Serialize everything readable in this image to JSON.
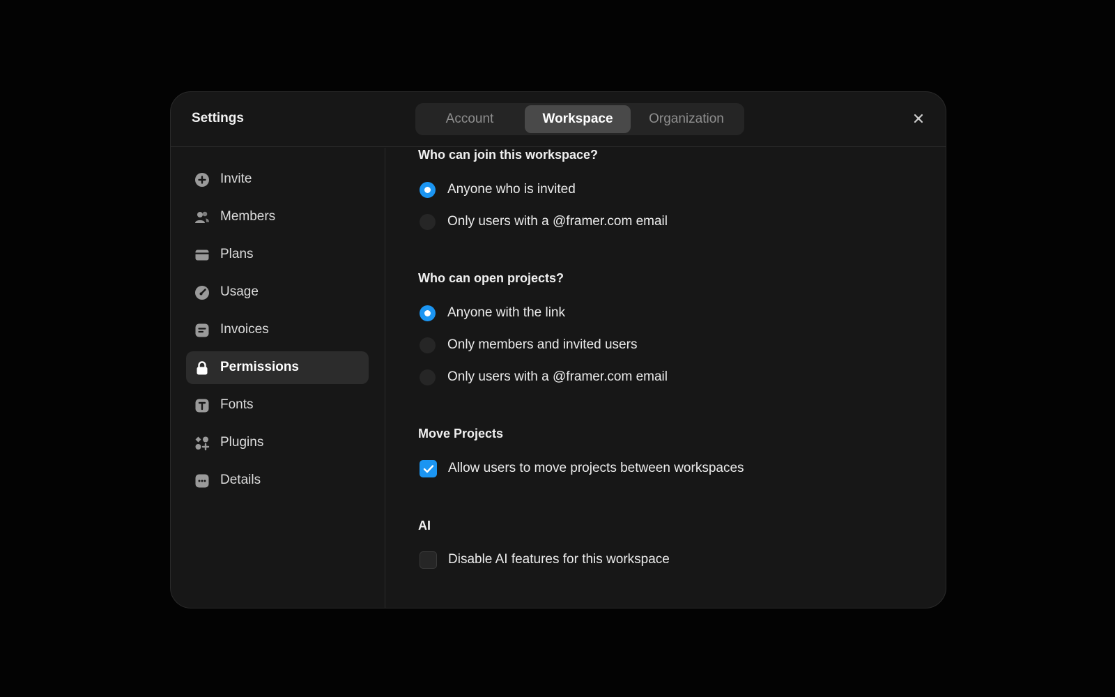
{
  "header": {
    "title": "Settings",
    "tabs": [
      {
        "label": "Account",
        "active": false
      },
      {
        "label": "Workspace",
        "active": true
      },
      {
        "label": "Organization",
        "active": false
      }
    ],
    "close_icon": "close-icon"
  },
  "sidebar": {
    "items": [
      {
        "label": "Invite",
        "icon": "plus-circle-icon",
        "active": false
      },
      {
        "label": "Members",
        "icon": "members-icon",
        "active": false
      },
      {
        "label": "Plans",
        "icon": "card-icon",
        "active": false
      },
      {
        "label": "Usage",
        "icon": "gauge-icon",
        "active": false
      },
      {
        "label": "Invoices",
        "icon": "invoice-icon",
        "active": false
      },
      {
        "label": "Permissions",
        "icon": "lock-icon",
        "active": true
      },
      {
        "label": "Fonts",
        "icon": "font-icon",
        "active": false
      },
      {
        "label": "Plugins",
        "icon": "plugins-icon",
        "active": false
      },
      {
        "label": "Details",
        "icon": "details-icon",
        "active": false
      }
    ]
  },
  "permissions": {
    "join": {
      "title": "Who can join this workspace?",
      "options": [
        {
          "label": "Anyone who is invited",
          "selected": true
        },
        {
          "label": "Only users with a @framer.com email",
          "selected": false
        }
      ]
    },
    "open": {
      "title": "Who can open projects?",
      "options": [
        {
          "label": "Anyone with the link",
          "selected": true
        },
        {
          "label": "Only members and invited users",
          "selected": false
        },
        {
          "label": "Only users with a @framer.com email",
          "selected": false
        }
      ]
    },
    "move": {
      "title": "Move Projects",
      "checkbox": {
        "label": "Allow users to move projects between workspaces",
        "checked": true
      }
    },
    "ai": {
      "title": "AI",
      "checkbox": {
        "label": "Disable AI features for this workspace",
        "checked": false
      }
    }
  },
  "colors": {
    "accent": "#1b95f2",
    "modal_bg": "#171717",
    "page_bg": "#030303"
  }
}
